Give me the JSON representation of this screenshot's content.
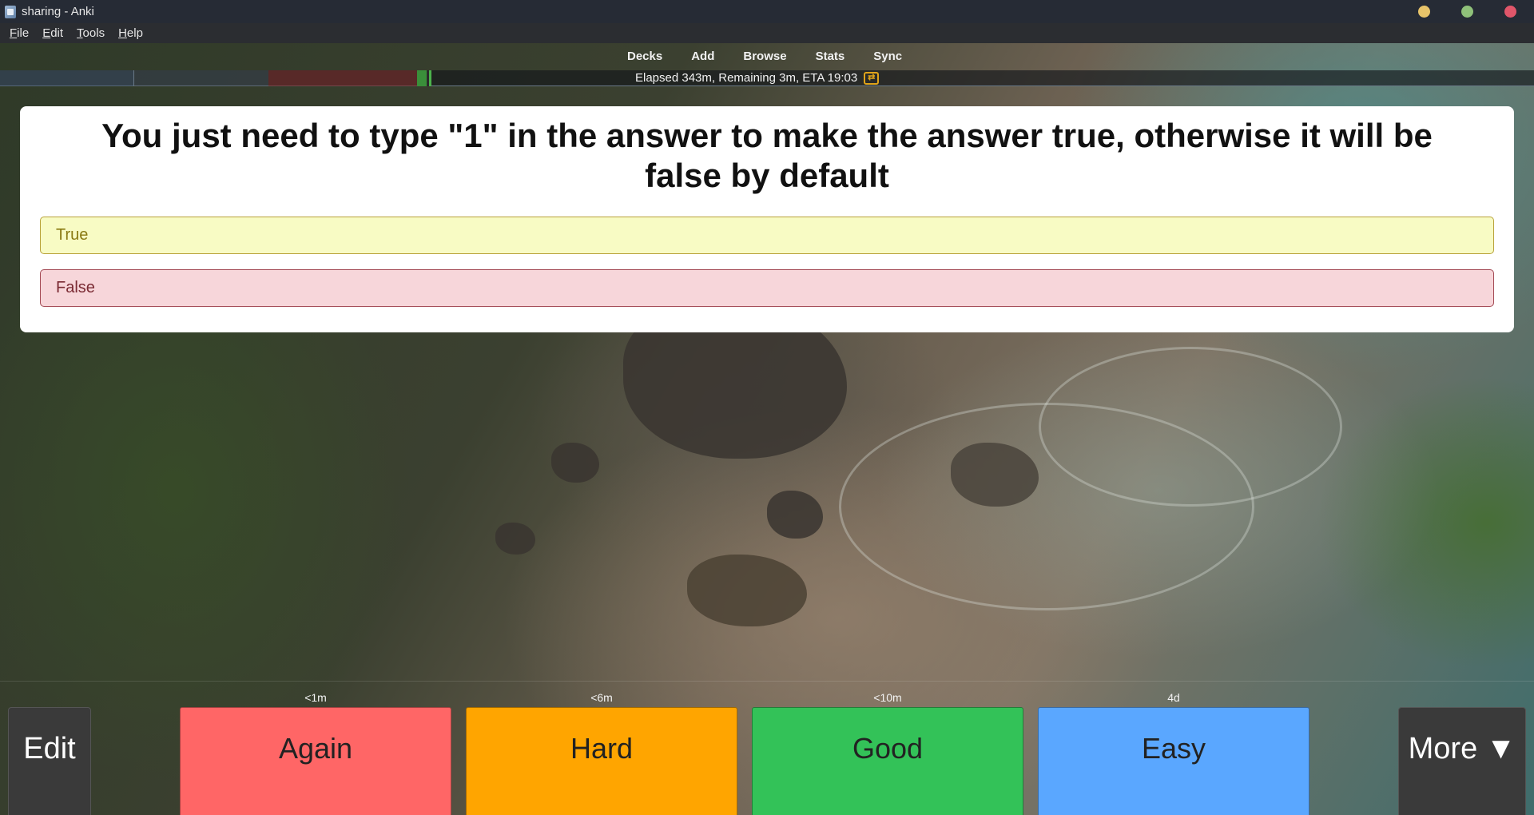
{
  "window": {
    "title": "sharing - Anki",
    "controls": [
      {
        "name": "minimize",
        "color": "#e8c46a"
      },
      {
        "name": "maximize",
        "color": "#8fc17a"
      },
      {
        "name": "close",
        "color": "#e0566a"
      }
    ]
  },
  "menu": {
    "items": [
      {
        "label": "File"
      },
      {
        "label": "Edit"
      },
      {
        "label": "Tools"
      },
      {
        "label": "Help"
      }
    ]
  },
  "toolbar": {
    "links": [
      "Decks",
      "Add",
      "Browse",
      "Stats",
      "Sync"
    ]
  },
  "status": {
    "text": "Elapsed 343m, Remaining 3m, ETA 19:03",
    "sync_icon": "sync-arrows-icon",
    "accent": "#e0a41a"
  },
  "card": {
    "question": "You just need to type \"1\" in the answer to make the answer true, otherwise it will be false by default",
    "options": [
      {
        "label": "True",
        "state": "correct"
      },
      {
        "label": "False",
        "state": "incorrect"
      }
    ]
  },
  "answer_buttons": [
    {
      "label": "Again",
      "interval": "<1m",
      "color": "#ff6666"
    },
    {
      "label": "Hard",
      "interval": "<6m",
      "color": "#ffa500"
    },
    {
      "label": "Good",
      "interval": "<10m",
      "color": "#33c258"
    },
    {
      "label": "Easy",
      "interval": "4d",
      "color": "#5aa7ff"
    }
  ],
  "edit_button": {
    "label": "Edit"
  },
  "more_button": {
    "label": "More ▼"
  }
}
